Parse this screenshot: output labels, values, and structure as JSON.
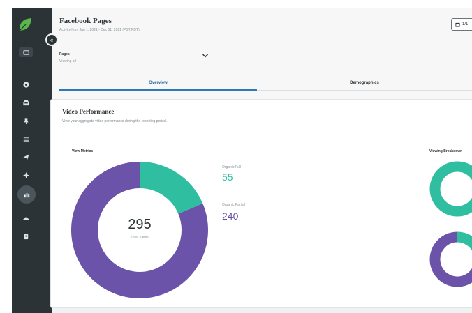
{
  "header": {
    "title": "Facebook Pages",
    "subtitle": "Activity from Jan 1, 2021 - Dec 31, 2021 (PST/PDT)",
    "date_button_label": "1/1"
  },
  "filters": {
    "pages_label": "Pages",
    "pages_value": "Viewing all"
  },
  "tabs": [
    {
      "label": "Overview",
      "active": true
    },
    {
      "label": "Demographics",
      "active": false
    }
  ],
  "card": {
    "title": "Video Performance",
    "subtitle": "View your aggregate video performance during the reporting period."
  },
  "view_metrics": {
    "title": "View Metrics",
    "total_value": "295",
    "total_label": "Total Views",
    "legend": [
      {
        "label": "Organic Full",
        "value": "55",
        "color": "#2fbfa0"
      },
      {
        "label": "Organic Partial",
        "value": "240",
        "color": "#6a53a9"
      }
    ]
  },
  "viewing_breakdown": {
    "title": "Viewing Breakdown"
  },
  "chart_data": [
    {
      "type": "pie",
      "categories": [
        "Organic Full",
        "Organic Partial"
      ],
      "values": [
        55,
        240
      ],
      "colors": [
        "#2fbfa0",
        "#6a53a9"
      ]
    },
    {
      "type": "pie",
      "values": [
        1,
        0
      ],
      "colors": [
        "#2fbfa0",
        "#6a53a9"
      ]
    },
    {
      "type": "pie",
      "values": [
        0.18,
        0.82
      ],
      "colors": [
        "#2fbfa0",
        "#6a53a9"
      ]
    }
  ],
  "colors": {
    "sidebar": "#2b3336",
    "accent_blue": "#2e78b7",
    "teal": "#2fbfa0",
    "purple": "#6a53a9"
  },
  "sidebar": {
    "items": [
      {
        "icon": "compose-icon"
      },
      {
        "icon": "messages-icon"
      },
      {
        "icon": "inbox-icon"
      },
      {
        "icon": "pin-icon"
      },
      {
        "icon": "list-icon"
      },
      {
        "icon": "send-icon"
      },
      {
        "icon": "listening-icon"
      },
      {
        "icon": "reports-icon",
        "active": true
      },
      {
        "icon": "automation-icon"
      },
      {
        "icon": "apps-icon"
      }
    ]
  }
}
